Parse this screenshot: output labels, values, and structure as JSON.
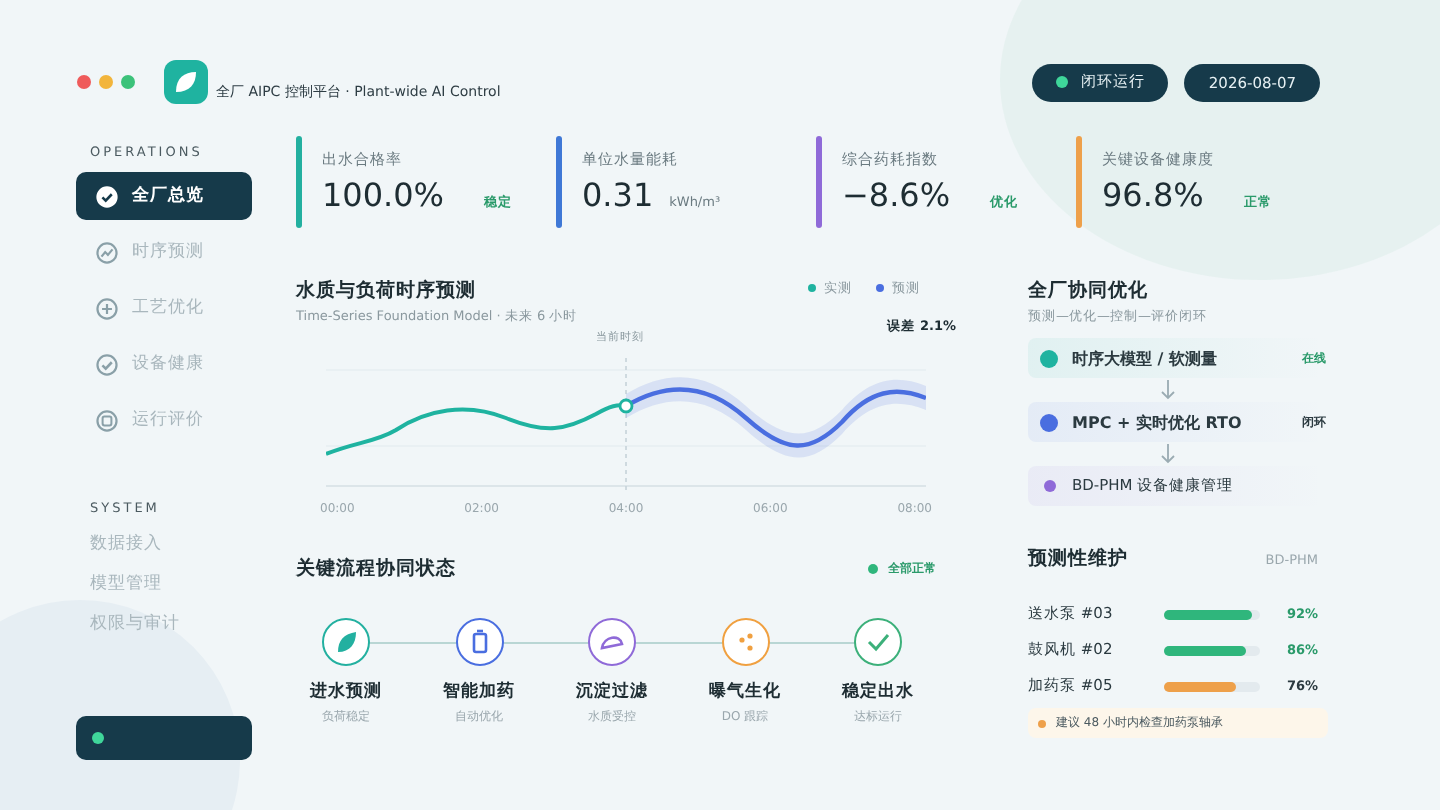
{
  "header": {
    "subtitle": "全厂 AIPC 控制平台 · Plant-wide AI Control",
    "status": {
      "label": "闭环运行",
      "on": true
    },
    "date": "2026-08-07"
  },
  "sidebar": {
    "sections": [
      {
        "title": "OPERATIONS",
        "items": [
          {
            "label": "全厂总览",
            "kind": "check",
            "selected": true
          },
          {
            "label": "时序预测",
            "kind": "trend",
            "selected": false
          },
          {
            "label": "工艺优化",
            "kind": "plus",
            "selected": false
          },
          {
            "label": "设备健康",
            "kind": "check",
            "selected": false
          },
          {
            "label": "运行评价",
            "kind": "square",
            "selected": false
          }
        ]
      },
      {
        "title": "SYSTEM",
        "items": [
          {
            "label": "数据接入",
            "selected": false
          },
          {
            "label": "模型管理",
            "selected": false
          },
          {
            "label": "权限与审计",
            "selected": false
          }
        ]
      }
    ],
    "footer": {
      "on": true
    }
  },
  "kpis": [
    {
      "label": "出水合格率",
      "value": "100.0%",
      "badge": "稳定",
      "color": "#23b0a0"
    },
    {
      "label": "单位水量能耗",
      "value": "0.31",
      "unit": "kWh/m³",
      "color": "#3f78d6"
    },
    {
      "label": "综合药耗指数",
      "value": "−8.6%",
      "badge": "优化",
      "color": "#8f6ad8"
    },
    {
      "label": "关键设备健康度",
      "value": "96.8%",
      "badge": "正常",
      "color": "#eea04a"
    }
  ],
  "forecast": {
    "title": "水质与负荷时序预测",
    "subtitle": "Time-Series Foundation Model  ·  未来 6 小时",
    "legend": [
      {
        "label": "实测",
        "color": "#1fb3a0"
      },
      {
        "label": "预测",
        "color": "#4a6ee0"
      }
    ],
    "marker": "当前时刻",
    "error": "误差 2.1%",
    "xticks": [
      "00:00",
      "02:00",
      "04:00",
      "06:00",
      "08:00"
    ]
  },
  "flow": {
    "title": "关键流程协同状态",
    "badge": "全部正常",
    "steps": [
      {
        "name": "进水预测",
        "sub": "负荷稳定",
        "kind": "leaf",
        "color": "#23b0a0"
      },
      {
        "name": "智能加药",
        "sub": "自动优化",
        "kind": "bottle",
        "color": "#4a6ee0"
      },
      {
        "name": "沉淀过滤",
        "sub": "水质受控",
        "kind": "arc",
        "color": "#8f6ad8"
      },
      {
        "name": "曝气生化",
        "sub": "DO 跟踪",
        "kind": "dots",
        "color": "#f0a040"
      },
      {
        "name": "稳定出水",
        "sub": "达标运行",
        "kind": "check",
        "color": "#3cb07a"
      }
    ]
  },
  "optimization": {
    "title": "全厂协同优化",
    "subtitle": "预测—优化—控制—评价闭环",
    "layers": [
      {
        "label": "时序大模型 / 软测量",
        "status": "在线",
        "color": "#1fb3a0"
      },
      {
        "label": "MPC + 实时优化 RTO",
        "status": "闭环",
        "color": "#4a6ee0"
      },
      {
        "label": "BD-PHM 设备健康管理",
        "color": "#8f6ad8"
      }
    ]
  },
  "maintenance": {
    "title": "预测性维护",
    "tag": "BD-PHM",
    "rows": [
      {
        "name": "送水泵 #03",
        "level": 0.92,
        "reading": "92%",
        "color": "#2fb67c"
      },
      {
        "name": "鼓风机 #02",
        "level": 0.86,
        "reading": "86%",
        "color": "#2fb67c"
      },
      {
        "name": "加药泵 #05",
        "level": 0.76,
        "reading": "76%",
        "color": "#eea04a"
      }
    ],
    "alert": "建议 48 小时内检查加药泵轴承"
  }
}
